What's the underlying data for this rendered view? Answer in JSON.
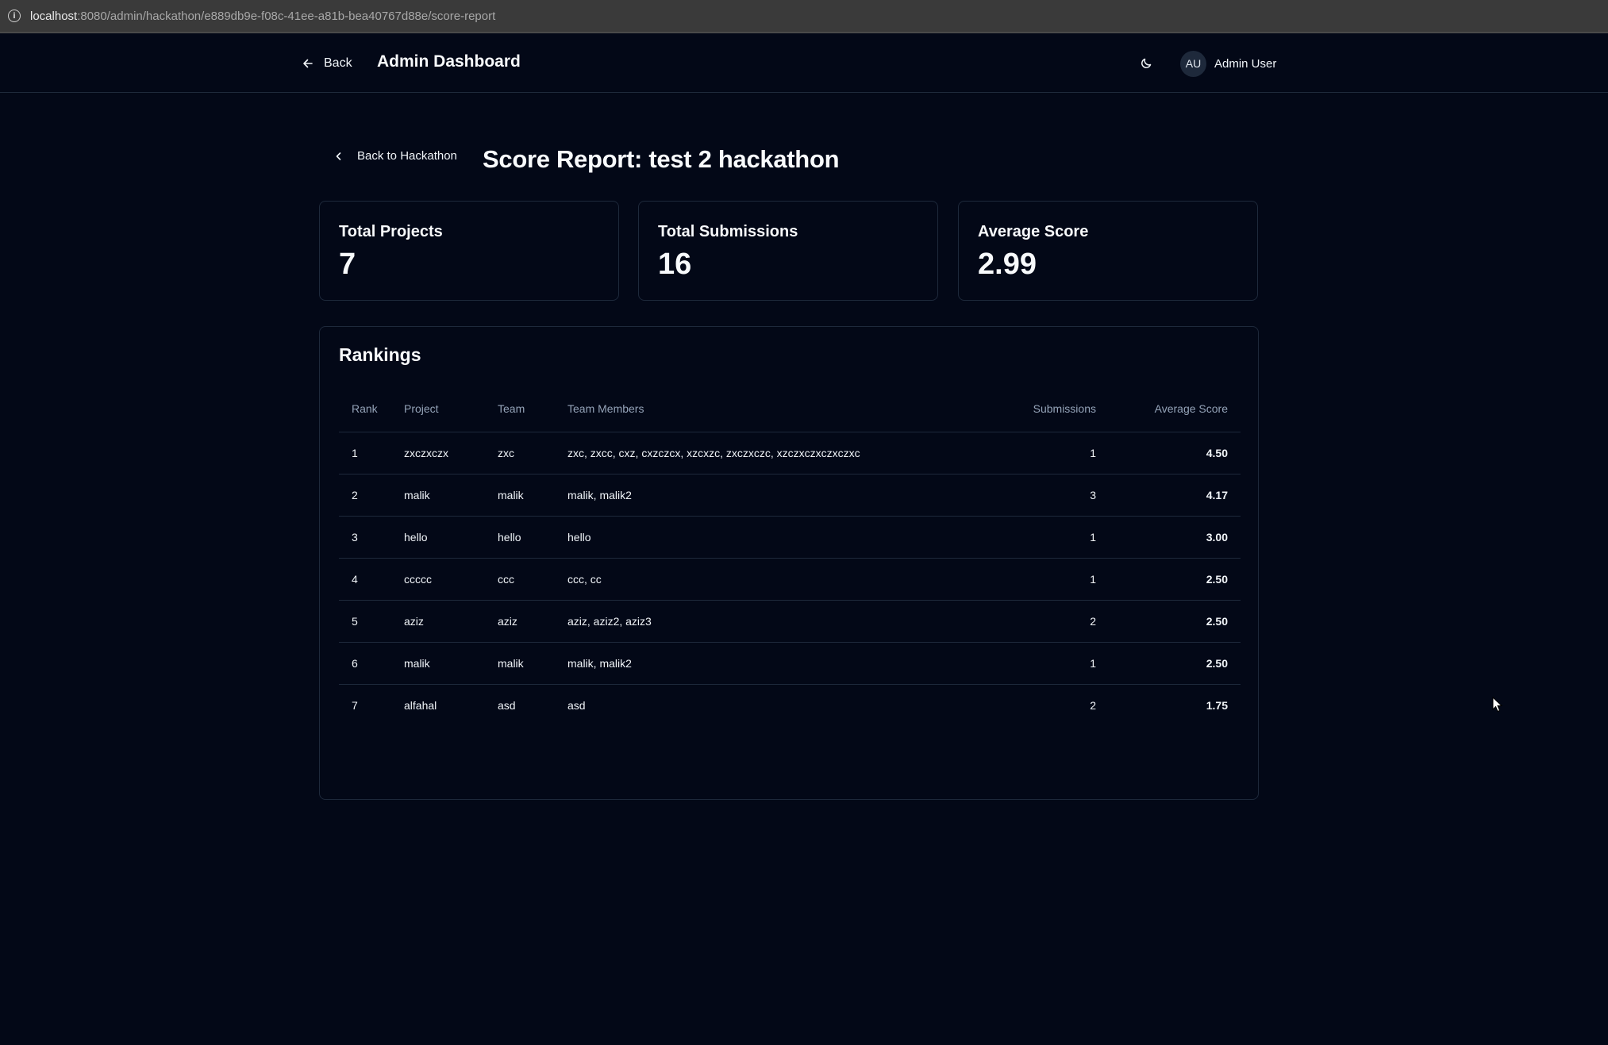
{
  "browser": {
    "url_host": "localhost",
    "url_rest": ":8080/admin/hackathon/e889db9e-f08c-41ee-a81b-bea40767d88e/score-report"
  },
  "header": {
    "back_label": "Back",
    "title": "Admin Dashboard",
    "theme_icon": "moon-icon",
    "user": {
      "initials": "AU",
      "name": "Admin User"
    }
  },
  "page": {
    "back_label": "Back to Hackathon",
    "title": "Score Report: test 2 hackathon"
  },
  "stats": [
    {
      "label": "Total Projects",
      "value": "7"
    },
    {
      "label": "Total Submissions",
      "value": "16"
    },
    {
      "label": "Average Score",
      "value": "2.99"
    }
  ],
  "rankings": {
    "title": "Rankings",
    "columns": [
      "Rank",
      "Project",
      "Team",
      "Team Members",
      "Submissions",
      "Average Score"
    ],
    "rows": [
      {
        "rank": "1",
        "project": "zxczxczx",
        "team": "zxc",
        "members": "zxc, zxcc, cxz, cxzczcx, xzcxzc, zxczxczc, xzczxczxczxczxc",
        "submissions": "1",
        "avg": "4.50"
      },
      {
        "rank": "2",
        "project": "malik",
        "team": "malik",
        "members": "malik, malik2",
        "submissions": "3",
        "avg": "4.17"
      },
      {
        "rank": "3",
        "project": "hello",
        "team": "hello",
        "members": "hello",
        "submissions": "1",
        "avg": "3.00"
      },
      {
        "rank": "4",
        "project": "ccccc",
        "team": "ccc",
        "members": "ccc, cc",
        "submissions": "1",
        "avg": "2.50"
      },
      {
        "rank": "5",
        "project": "aziz",
        "team": "aziz",
        "members": "aziz, aziz2, aziz3",
        "submissions": "2",
        "avg": "2.50"
      },
      {
        "rank": "6",
        "project": "malik",
        "team": "malik",
        "members": "malik, malik2",
        "submissions": "1",
        "avg": "2.50"
      },
      {
        "rank": "7",
        "project": "alfahal",
        "team": "asd",
        "members": "asd",
        "submissions": "2",
        "avg": "1.75"
      }
    ]
  }
}
